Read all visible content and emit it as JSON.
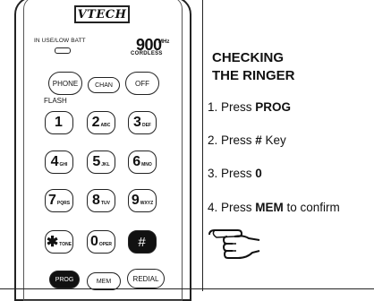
{
  "handset": {
    "brand": "VTECH",
    "indicator_label": "IN USE/LOW BATT",
    "frequency": "900",
    "frequency_unit": "MHz",
    "model_tag": "CORDLESS",
    "buttons": {
      "phone": "PHONE",
      "chan": "CHAN",
      "off": "OFF",
      "flash": "FLASH",
      "prog": "PROG",
      "mem": "MEM",
      "redial": "REDIAL"
    },
    "keypad": [
      {
        "digit": "1",
        "letters": ""
      },
      {
        "digit": "2",
        "letters": "ABC"
      },
      {
        "digit": "3",
        "letters": "DEF"
      },
      {
        "digit": "4",
        "letters": "GHI"
      },
      {
        "digit": "5",
        "letters": "JKL"
      },
      {
        "digit": "6",
        "letters": "MNO"
      },
      {
        "digit": "7",
        "letters": "PQRS"
      },
      {
        "digit": "8",
        "letters": "TUV"
      },
      {
        "digit": "9",
        "letters": "WXYZ"
      },
      {
        "digit": "✱",
        "letters": "TONE"
      },
      {
        "digit": "0",
        "letters": "OPER"
      },
      {
        "digit": "#",
        "letters": ""
      }
    ]
  },
  "instructions": {
    "title_line1": "CHECKING",
    "title_line2": "THE RINGER",
    "steps": [
      {
        "prefix": "1. Press ",
        "key": "PROG",
        "suffix": ""
      },
      {
        "prefix": "2. Press ",
        "key": "#",
        "suffix": " Key"
      },
      {
        "prefix": "3. Press ",
        "key": "0",
        "suffix": ""
      },
      {
        "prefix": "4. Press ",
        "key": "MEM",
        "suffix": " to confirm"
      }
    ]
  }
}
